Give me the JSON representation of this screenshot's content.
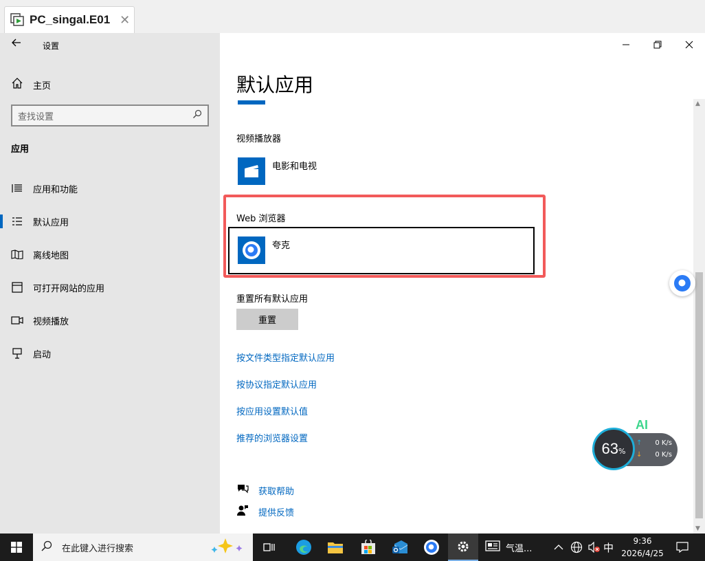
{
  "vm_tab": {
    "title": "PC_singal.E01",
    "close": "✕"
  },
  "left": {
    "settings_label": "设置",
    "home": "主页",
    "search_placeholder": "查找设置",
    "section_title": "应用",
    "nav": [
      {
        "label": "应用和功能",
        "icon": "apps-list-icon"
      },
      {
        "label": "默认应用",
        "icon": "default-apps-icon",
        "active": true
      },
      {
        "label": "离线地图",
        "icon": "offline-map-icon"
      },
      {
        "label": "可打开网站的应用",
        "icon": "web-apps-icon"
      },
      {
        "label": "视频播放",
        "icon": "video-icon"
      },
      {
        "label": "启动",
        "icon": "startup-icon"
      }
    ]
  },
  "main": {
    "title": "默认应用",
    "video_section": "视频播放器",
    "video_app": "电影和电视",
    "web_section": "Web 浏览器",
    "web_app": "夸克",
    "reset_section": "重置所有默认应用",
    "reset_button": "重置",
    "links": [
      "按文件类型指定默认应用",
      "按协议指定默认应用",
      "按应用设置默认值",
      "推荐的浏览器设置"
    ],
    "help": "获取帮助",
    "feedback": "提供反馈"
  },
  "speed_widget": {
    "ai": "AI",
    "percent": "63",
    "percent_sign": "%",
    "up": "0 K/s",
    "down": "0 K/s"
  },
  "taskbar": {
    "search_placeholder": "在此键入进行搜索",
    "weather": "气温...",
    "ime": "中",
    "time": "9:36",
    "date": "2026/4/25"
  },
  "colors": {
    "accent": "#0067c0",
    "highlight": "#f25a5a",
    "ai": "#3dd68c"
  }
}
